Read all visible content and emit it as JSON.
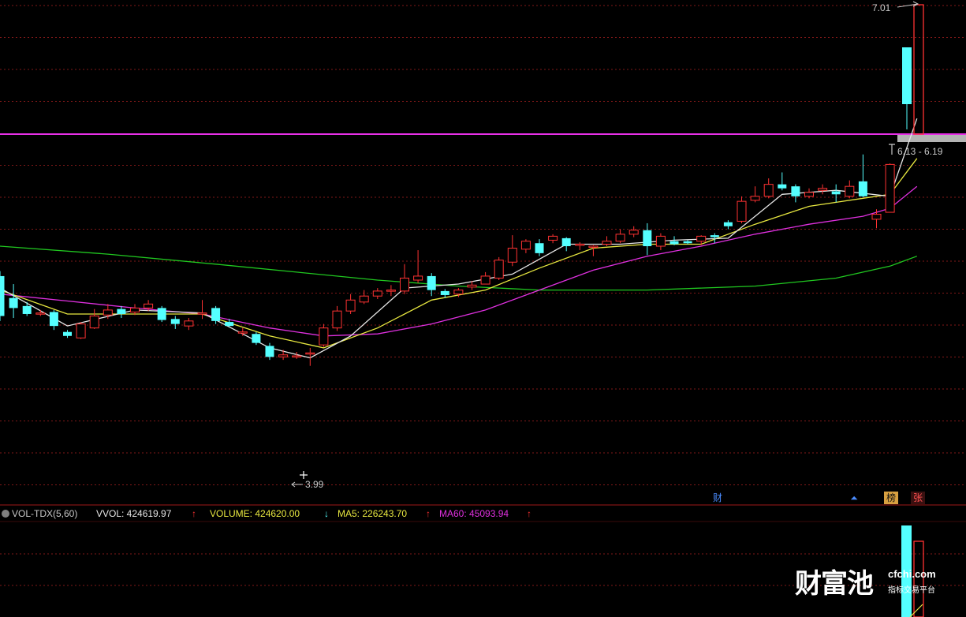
{
  "price_labels": {
    "high": "7.01",
    "low": "3.99",
    "range": "6.13 - 6.19"
  },
  "markers": {
    "cai": "财",
    "bang": "榜",
    "zhang": "张"
  },
  "volume_indicator": {
    "name": "VOL-TDX(5,60)",
    "vvol_label": "VVOL: 424619.97",
    "volume_label": "VOLUME: 424620.00",
    "ma5_label": "MA5: 226243.70",
    "ma60_label": "MA60: 45093.94",
    "up_arrow": "↑",
    "down_arrow": "↓"
  },
  "watermark": {
    "brand": "财富池",
    "domain": "cfchi.com",
    "slogan": "指标交易平台"
  },
  "colors": {
    "background": "#000000",
    "up": "#ff3232",
    "down": "#54ffff",
    "ma5": "#e6e6e6",
    "ma10": "#e8e840",
    "ma20": "#e030e0",
    "ma60": "#20c820",
    "limit_line": "#e830e8",
    "grid": "#801818"
  },
  "candles": [
    [
      6.0,
      5.6,
      6.05,
      5.55
    ],
    [
      5.78,
      5.68,
      5.92,
      5.58
    ],
    [
      5.7,
      5.62,
      5.74,
      5.6
    ],
    [
      5.63,
      5.63,
      5.66,
      5.6
    ],
    [
      5.64,
      5.5,
      5.66,
      5.46
    ],
    [
      5.44,
      5.4,
      5.46,
      5.38
    ],
    [
      5.38,
      5.52,
      5.54,
      5.37
    ],
    [
      5.48,
      5.6,
      5.67,
      5.47
    ],
    [
      5.61,
      5.66,
      5.72,
      5.57
    ],
    [
      5.67,
      5.62,
      5.7,
      5.58
    ],
    [
      5.64,
      5.68,
      5.72,
      5.61
    ],
    [
      5.68,
      5.72,
      5.76,
      5.65
    ],
    [
      5.68,
      5.56,
      5.7,
      5.54
    ],
    [
      5.57,
      5.52,
      5.6,
      5.47
    ],
    [
      5.5,
      5.55,
      5.58,
      5.46
    ],
    [
      5.63,
      5.63,
      5.76,
      5.57
    ],
    [
      5.68,
      5.55,
      5.7,
      5.52
    ],
    [
      5.54,
      5.5,
      5.57,
      5.49
    ],
    [
      5.44,
      5.44,
      5.48,
      5.4
    ],
    [
      5.42,
      5.33,
      5.44,
      5.31
    ],
    [
      5.3,
      5.19,
      5.33,
      5.16
    ],
    [
      5.19,
      5.21,
      5.26,
      5.16
    ],
    [
      5.19,
      5.2,
      5.24,
      5.17
    ],
    [
      5.23,
      5.23,
      5.28,
      5.1
    ],
    [
      5.31,
      5.48,
      5.52,
      5.29
    ],
    [
      5.48,
      5.65,
      5.7,
      5.45
    ],
    [
      5.65,
      5.76,
      5.82,
      5.62
    ],
    [
      5.74,
      5.8,
      5.86,
      5.72
    ],
    [
      5.8,
      5.85,
      5.88,
      5.77
    ],
    [
      5.85,
      5.86,
      5.91,
      5.8
    ],
    [
      5.85,
      5.98,
      6.12,
      5.82
    ],
    [
      5.96,
      6.0,
      6.26,
      5.93
    ],
    [
      6.0,
      5.86,
      6.03,
      5.8
    ],
    [
      5.85,
      5.81,
      5.87,
      5.78
    ],
    [
      5.82,
      5.86,
      5.88,
      5.79
    ],
    [
      5.89,
      5.91,
      5.95,
      5.86
    ],
    [
      5.92,
      6.0,
      6.04,
      5.92
    ],
    [
      5.98,
      6.16,
      6.19,
      5.96
    ],
    [
      6.14,
      6.28,
      6.41,
      6.1
    ],
    [
      6.27,
      6.35,
      6.37,
      6.23
    ],
    [
      6.33,
      6.23,
      6.37,
      6.2
    ],
    [
      6.36,
      6.4,
      6.42,
      6.33
    ],
    [
      6.38,
      6.3,
      6.39,
      6.25
    ],
    [
      6.32,
      6.32,
      6.34,
      6.26
    ],
    [
      6.3,
      6.3,
      6.31,
      6.2
    ],
    [
      6.32,
      6.35,
      6.4,
      6.3
    ],
    [
      6.35,
      6.42,
      6.47,
      6.33
    ],
    [
      6.42,
      6.46,
      6.5,
      6.39
    ],
    [
      6.46,
      6.3,
      6.53,
      6.21
    ],
    [
      6.3,
      6.4,
      6.43,
      6.26
    ],
    [
      6.35,
      6.32,
      6.4,
      6.31
    ],
    [
      6.35,
      6.33,
      6.36,
      6.32
    ],
    [
      6.35,
      6.4,
      6.41,
      6.31
    ],
    [
      6.41,
      6.39,
      6.43,
      6.33
    ],
    [
      6.54,
      6.5,
      6.56,
      6.47
    ],
    [
      6.55,
      6.75,
      6.8,
      6.53
    ],
    [
      6.76,
      6.8,
      6.9,
      6.74
    ],
    [
      6.8,
      6.92,
      6.98,
      6.78
    ],
    [
      6.92,
      6.88,
      7.04,
      6.86
    ],
    [
      6.9,
      6.8,
      6.92,
      6.74
    ],
    [
      6.8,
      6.84,
      6.88,
      6.78
    ],
    [
      6.86,
      6.88,
      6.92,
      6.82
    ],
    [
      6.85,
      6.82,
      6.92,
      6.74
    ],
    [
      6.8,
      6.9,
      6.96,
      6.78
    ],
    [
      6.95,
      6.8,
      7.22,
      6.79
    ],
    [
      6.57,
      6.62,
      6.67,
      6.48
    ],
    [
      6.64,
      7.12,
      7.13,
      6.64
    ]
  ],
  "ma5_curve": [
    [
      0,
      5.88
    ],
    [
      5,
      5.5
    ],
    [
      10,
      5.66
    ],
    [
      15,
      5.63
    ],
    [
      20,
      5.28
    ],
    [
      23,
      5.18
    ],
    [
      26,
      5.4
    ],
    [
      30,
      5.88
    ],
    [
      34,
      5.92
    ],
    [
      38,
      6.02
    ],
    [
      42,
      6.32
    ],
    [
      46,
      6.32
    ],
    [
      50,
      6.36
    ],
    [
      54,
      6.38
    ],
    [
      58,
      6.82
    ],
    [
      62,
      6.86
    ],
    [
      66,
      6.8
    ],
    [
      68,
      7.58
    ]
  ],
  "ma10_curve": [
    [
      0,
      5.86
    ],
    [
      5,
      5.62
    ],
    [
      10,
      5.62
    ],
    [
      15,
      5.62
    ],
    [
      20,
      5.4
    ],
    [
      24,
      5.28
    ],
    [
      28,
      5.48
    ],
    [
      32,
      5.76
    ],
    [
      36,
      5.86
    ],
    [
      40,
      6.08
    ],
    [
      44,
      6.28
    ],
    [
      48,
      6.32
    ],
    [
      52,
      6.32
    ],
    [
      56,
      6.52
    ],
    [
      60,
      6.7
    ],
    [
      64,
      6.78
    ],
    [
      66,
      6.82
    ],
    [
      68,
      7.18
    ]
  ],
  "ma20_curve": [
    [
      0,
      5.82
    ],
    [
      5,
      5.75
    ],
    [
      10,
      5.68
    ],
    [
      15,
      5.62
    ],
    [
      20,
      5.48
    ],
    [
      24,
      5.4
    ],
    [
      28,
      5.42
    ],
    [
      32,
      5.52
    ],
    [
      36,
      5.66
    ],
    [
      40,
      5.86
    ],
    [
      44,
      6.06
    ],
    [
      48,
      6.2
    ],
    [
      52,
      6.3
    ],
    [
      56,
      6.42
    ],
    [
      60,
      6.52
    ],
    [
      64,
      6.6
    ],
    [
      66,
      6.68
    ],
    [
      68,
      6.9
    ]
  ],
  "ma60_curve": [
    [
      0,
      6.3
    ],
    [
      8,
      6.22
    ],
    [
      16,
      6.12
    ],
    [
      22,
      6.04
    ],
    [
      28,
      5.96
    ],
    [
      34,
      5.9
    ],
    [
      40,
      5.86
    ],
    [
      48,
      5.86
    ],
    [
      56,
      5.9
    ],
    [
      62,
      5.98
    ],
    [
      66,
      6.1
    ],
    [
      68,
      6.2
    ]
  ],
  "volume_bars": [
    [
      66,
      1.0,
      "down"
    ],
    [
      67,
      0.88,
      "up"
    ]
  ]
}
